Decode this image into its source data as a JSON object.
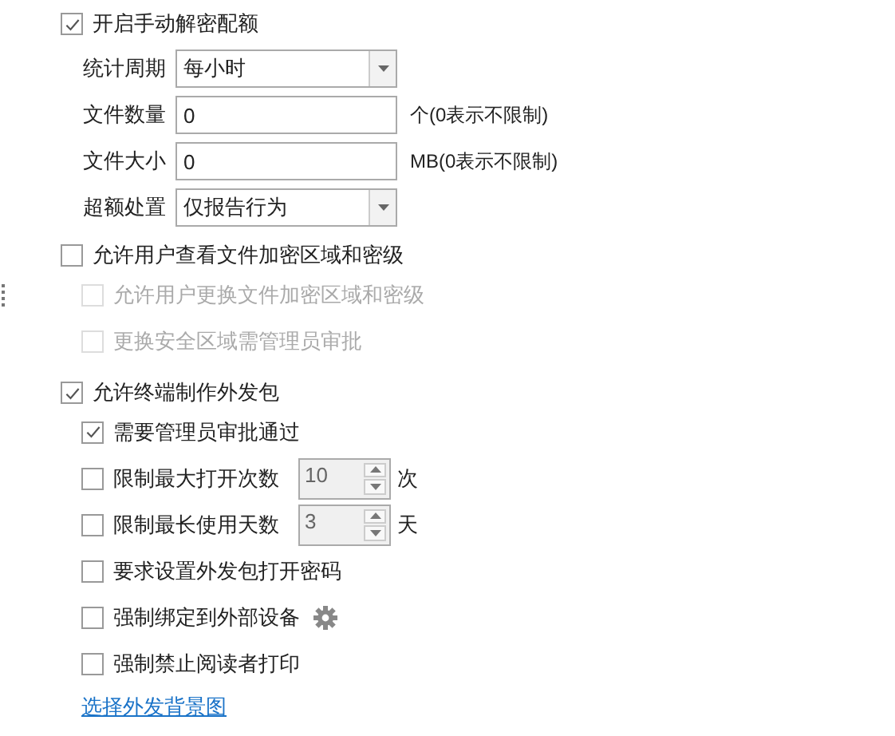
{
  "quota": {
    "label": "开启手动解密配额",
    "checked": true,
    "fields": [
      {
        "kind": "select",
        "label": "统计周期",
        "value": "每小时"
      },
      {
        "kind": "input",
        "label": "文件数量",
        "value": "0",
        "suffix": "个(0表示不限制)"
      },
      {
        "kind": "input",
        "label": "文件大小",
        "value": "0",
        "suffix": "MB(0表示不限制)"
      },
      {
        "kind": "select",
        "label": "超额处置",
        "value": "仅报告行为"
      }
    ]
  },
  "options": [
    {
      "label": "允许用户查看文件加密区域和密级",
      "checked": false,
      "disabled": false,
      "children": [
        {
          "kind": "check",
          "label": "允许用户更换文件加密区域和密级",
          "checked": false,
          "disabled": true
        },
        {
          "kind": "check",
          "label": "更换安全区域需管理员审批",
          "checked": false,
          "disabled": true
        }
      ]
    },
    {
      "label": "允许终端制作外发包",
      "checked": true,
      "disabled": false,
      "children": [
        {
          "kind": "check",
          "label": "需要管理员审批通过",
          "checked": true,
          "disabled": false
        },
        {
          "kind": "spin",
          "label": "限制最大打开次数",
          "checked": false,
          "disabled": false,
          "value": "10",
          "unit": "次"
        },
        {
          "kind": "spin",
          "label": "限制最长使用天数",
          "checked": false,
          "disabled": false,
          "value": "3",
          "unit": "天"
        },
        {
          "kind": "check",
          "label": "要求设置外发包打开密码",
          "checked": false,
          "disabled": false
        },
        {
          "kind": "gear",
          "label": "强制绑定到外部设备",
          "checked": false,
          "disabled": false
        },
        {
          "kind": "check",
          "label": "强制禁止阅读者打印",
          "checked": false,
          "disabled": false
        }
      ]
    }
  ],
  "link": "选择外发背景图"
}
